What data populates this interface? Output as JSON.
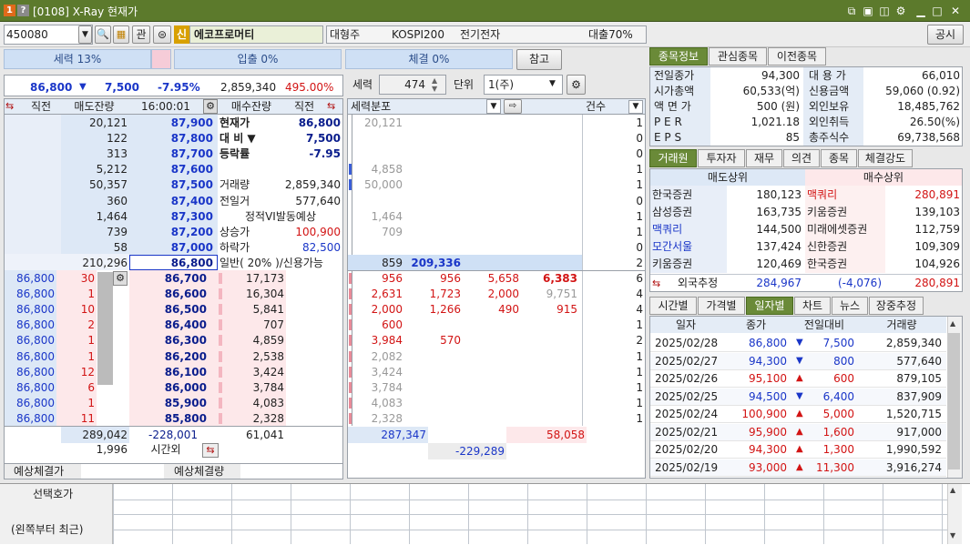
{
  "window": {
    "title": "[0108] X-Ray 현재가",
    "icon1": "1",
    "icon2": "?"
  },
  "header": {
    "code": "450080",
    "badge": "신",
    "name": "에코프로머티",
    "category": "대형주",
    "index": "KOSPI200",
    "sector": "전기전자",
    "loan": "대출70%",
    "gongsi": "공시"
  },
  "power": {
    "label": "세력 13%",
    "entry": "입출 0%",
    "exec": "체결 0%",
    "ref_btn": "참고"
  },
  "price_line": {
    "price": "86,800",
    "arrow": "▼",
    "change": "7,500",
    "rate": "-7.95%",
    "volume": "2,859,340",
    "ratio": "495.00%"
  },
  "mid_ctrl": {
    "label": "세력",
    "value": "474",
    "unit_label": "단위",
    "unit": "1(주)"
  },
  "book_head": {
    "c1": "직전",
    "c2": "매도잔량",
    "time": "16:00:01",
    "c4": "매수잔량",
    "c5": "직전"
  },
  "sell_rows": [
    {
      "qty": "20,121",
      "price": "87,900"
    },
    {
      "qty": "122",
      "price": "87,800"
    },
    {
      "qty": "313",
      "price": "87,700"
    },
    {
      "qty": "5,212",
      "price": "87,600"
    },
    {
      "qty": "50,357",
      "price": "87,500"
    },
    {
      "qty": "360",
      "price": "87,400"
    },
    {
      "qty": "1,464",
      "price": "87,300"
    },
    {
      "qty": "739",
      "price": "87,200"
    },
    {
      "qty": "58",
      "price": "87,000"
    },
    {
      "qty": "210,296",
      "price": "86,800"
    }
  ],
  "info_rows": [
    {
      "k": "현재가",
      "v": "86,800"
    },
    {
      "k": "대  비  ▼",
      "v": "7,500"
    },
    {
      "k": "등락률",
      "v": "-7.95"
    },
    {
      "k": "",
      "v": ""
    },
    {
      "k": "거래량",
      "v": "2,859,340"
    },
    {
      "k": "전일거",
      "v": "577,640"
    },
    {
      "k": "정적VI발동예상",
      "v": ""
    },
    {
      "k": "상승가",
      "v": "100,900"
    },
    {
      "k": "하락가",
      "v": "82,500"
    },
    {
      "k": "일반( 20% )/신용가능",
      "v": ""
    }
  ],
  "buy_rows": [
    {
      "prev": "86,800",
      "n": "30",
      "price": "86,700",
      "qty": "17,173"
    },
    {
      "prev": "86,800",
      "n": "1",
      "price": "86,600",
      "qty": "16,304"
    },
    {
      "prev": "86,800",
      "n": "10",
      "price": "86,500",
      "qty": "5,841"
    },
    {
      "prev": "86,800",
      "n": "2",
      "price": "86,400",
      "qty": "707"
    },
    {
      "prev": "86,800",
      "n": "1",
      "price": "86,300",
      "qty": "4,859"
    },
    {
      "prev": "86,800",
      "n": "1",
      "price": "86,200",
      "qty": "2,538"
    },
    {
      "prev": "86,800",
      "n": "12",
      "price": "86,100",
      "qty": "3,424"
    },
    {
      "prev": "86,800",
      "n": "6",
      "price": "86,000",
      "qty": "3,784"
    },
    {
      "prev": "86,800",
      "n": "1",
      "price": "85,900",
      "qty": "4,083"
    },
    {
      "prev": "86,800",
      "n": "11",
      "price": "85,800",
      "qty": "2,328"
    }
  ],
  "book_foot": {
    "sell_total": "289,042",
    "diff": "-228,001",
    "buy_total": "61,041",
    "after_qty": "1,996",
    "after_label": "시간외"
  },
  "expect": {
    "l1": "예상체결가",
    "l2": "예상체결량"
  },
  "dist_head": {
    "label": "세력분포",
    "cnt": "건수"
  },
  "dist_sell": [
    {
      "a": "20,121",
      "b": "",
      "cnt": "1"
    },
    {
      "a": "",
      "b": "",
      "cnt": "0"
    },
    {
      "a": "",
      "b": "",
      "cnt": "0"
    },
    {
      "a": "4,858",
      "b": "",
      "cnt": "1"
    },
    {
      "a": "50,000",
      "b": "",
      "cnt": "1"
    },
    {
      "a": "",
      "b": "",
      "cnt": "0"
    },
    {
      "a": "1,464",
      "b": "",
      "cnt": "1"
    },
    {
      "a": "709",
      "b": "",
      "cnt": "1"
    },
    {
      "a": "",
      "b": "",
      "cnt": "0"
    },
    {
      "a": "859",
      "b": "209,336",
      "cnt": "2"
    }
  ],
  "dist_buy": [
    {
      "a": "956",
      "b": "956",
      "c": "5,658",
      "d": "6,383",
      "cnt": "6"
    },
    {
      "a": "2,631",
      "b": "1,723",
      "c": "2,000",
      "d": "9,751",
      "cnt": "4"
    },
    {
      "a": "2,000",
      "b": "1,266",
      "c": "490",
      "d": "915",
      "cnt": "4"
    },
    {
      "a": "600",
      "b": "",
      "c": "",
      "d": "",
      "cnt": "1"
    },
    {
      "a": "3,984",
      "b": "570",
      "c": "",
      "d": "",
      "cnt": "2"
    },
    {
      "a": "2,082",
      "b": "",
      "c": "",
      "d": "",
      "cnt": "1"
    },
    {
      "a": "3,424",
      "b": "",
      "c": "",
      "d": "",
      "cnt": "1"
    },
    {
      "a": "3,784",
      "b": "",
      "c": "",
      "d": "",
      "cnt": "1"
    },
    {
      "a": "4,083",
      "b": "",
      "c": "",
      "d": "",
      "cnt": "1"
    },
    {
      "a": "2,328",
      "b": "",
      "c": "",
      "d": "",
      "cnt": "1"
    }
  ],
  "dist_foot": {
    "left": "287,347",
    "right": "58,058",
    "diff": "-229,289"
  },
  "right_tabs1": [
    "종목정보",
    "관심종목",
    "이전종목"
  ],
  "stock_info": [
    {
      "k1": "전일종가",
      "v1": "94,300",
      "k2": "대 용 가",
      "v2": "66,010"
    },
    {
      "k1": "시가총액",
      "v1": "60,533(억)",
      "k2": "신용금액",
      "v2": "59,060  (0.92)"
    },
    {
      "k1": "액 면 가",
      "v1": "500 (원)",
      "k2": "외인보유",
      "v2": "18,485,762"
    },
    {
      "k1": "P E R",
      "v1": "1,021.18",
      "k2": "외인취득",
      "v2": "26.50(%)"
    },
    {
      "k1": "E P S",
      "v1": "85",
      "k2": "총주식수",
      "v2": "69,738,568"
    }
  ],
  "right_tabs2": [
    "거래원",
    "투자자",
    "재무",
    "의견",
    "종목",
    "체결강도"
  ],
  "broker_head": {
    "sell": "매도상위",
    "buy": "매수상위"
  },
  "brokers": [
    {
      "sn": "한국증권",
      "sv": "180,123",
      "bn": "맥쿼리",
      "bv": "280,891"
    },
    {
      "sn": "삼성증권",
      "sv": "163,735",
      "bn": "키움증권",
      "bv": "139,103"
    },
    {
      "sn": "맥쿼리",
      "sv": "144,500",
      "bn": "미래에셋증권",
      "bv": "112,759"
    },
    {
      "sn": "모간서울",
      "sv": "137,424",
      "bn": "신한증권",
      "bv": "109,309"
    },
    {
      "sn": "키움증권",
      "sv": "120,469",
      "bn": "한국증권",
      "bv": "104,926"
    }
  ],
  "foreign": {
    "label": "외국추정",
    "sell": "284,967",
    "net": "(-4,076)",
    "buy": "280,891"
  },
  "right_tabs3": [
    "시간별",
    "가격별",
    "일자별",
    "차트",
    "뉴스",
    "장중추정"
  ],
  "daily_head": {
    "date": "일자",
    "close": "종가",
    "chg": "전일대비",
    "vol": "거래량"
  },
  "daily": [
    {
      "date": "2025/02/28",
      "close": "86,800",
      "dir": "▼",
      "chg": "7,500",
      "vol": "2,859,340"
    },
    {
      "date": "2025/02/27",
      "close": "94,300",
      "dir": "▼",
      "chg": "800",
      "vol": "577,640"
    },
    {
      "date": "2025/02/26",
      "close": "95,100",
      "dir": "▲",
      "chg": "600",
      "vol": "879,105"
    },
    {
      "date": "2025/02/25",
      "close": "94,500",
      "dir": "▼",
      "chg": "6,400",
      "vol": "837,909"
    },
    {
      "date": "2025/02/24",
      "close": "100,900",
      "dir": "▲",
      "chg": "5,000",
      "vol": "1,520,715"
    },
    {
      "date": "2025/02/21",
      "close": "95,900",
      "dir": "▲",
      "chg": "1,600",
      "vol": "917,000"
    },
    {
      "date": "2025/02/20",
      "close": "94,300",
      "dir": "▲",
      "chg": "1,300",
      "vol": "1,990,592"
    },
    {
      "date": "2025/02/19",
      "close": "93,000",
      "dir": "▲",
      "chg": "11,300",
      "vol": "3,916,274"
    }
  ],
  "bottom": {
    "l1": "선택호가",
    "l2": "(왼쪽부터 최근)"
  }
}
